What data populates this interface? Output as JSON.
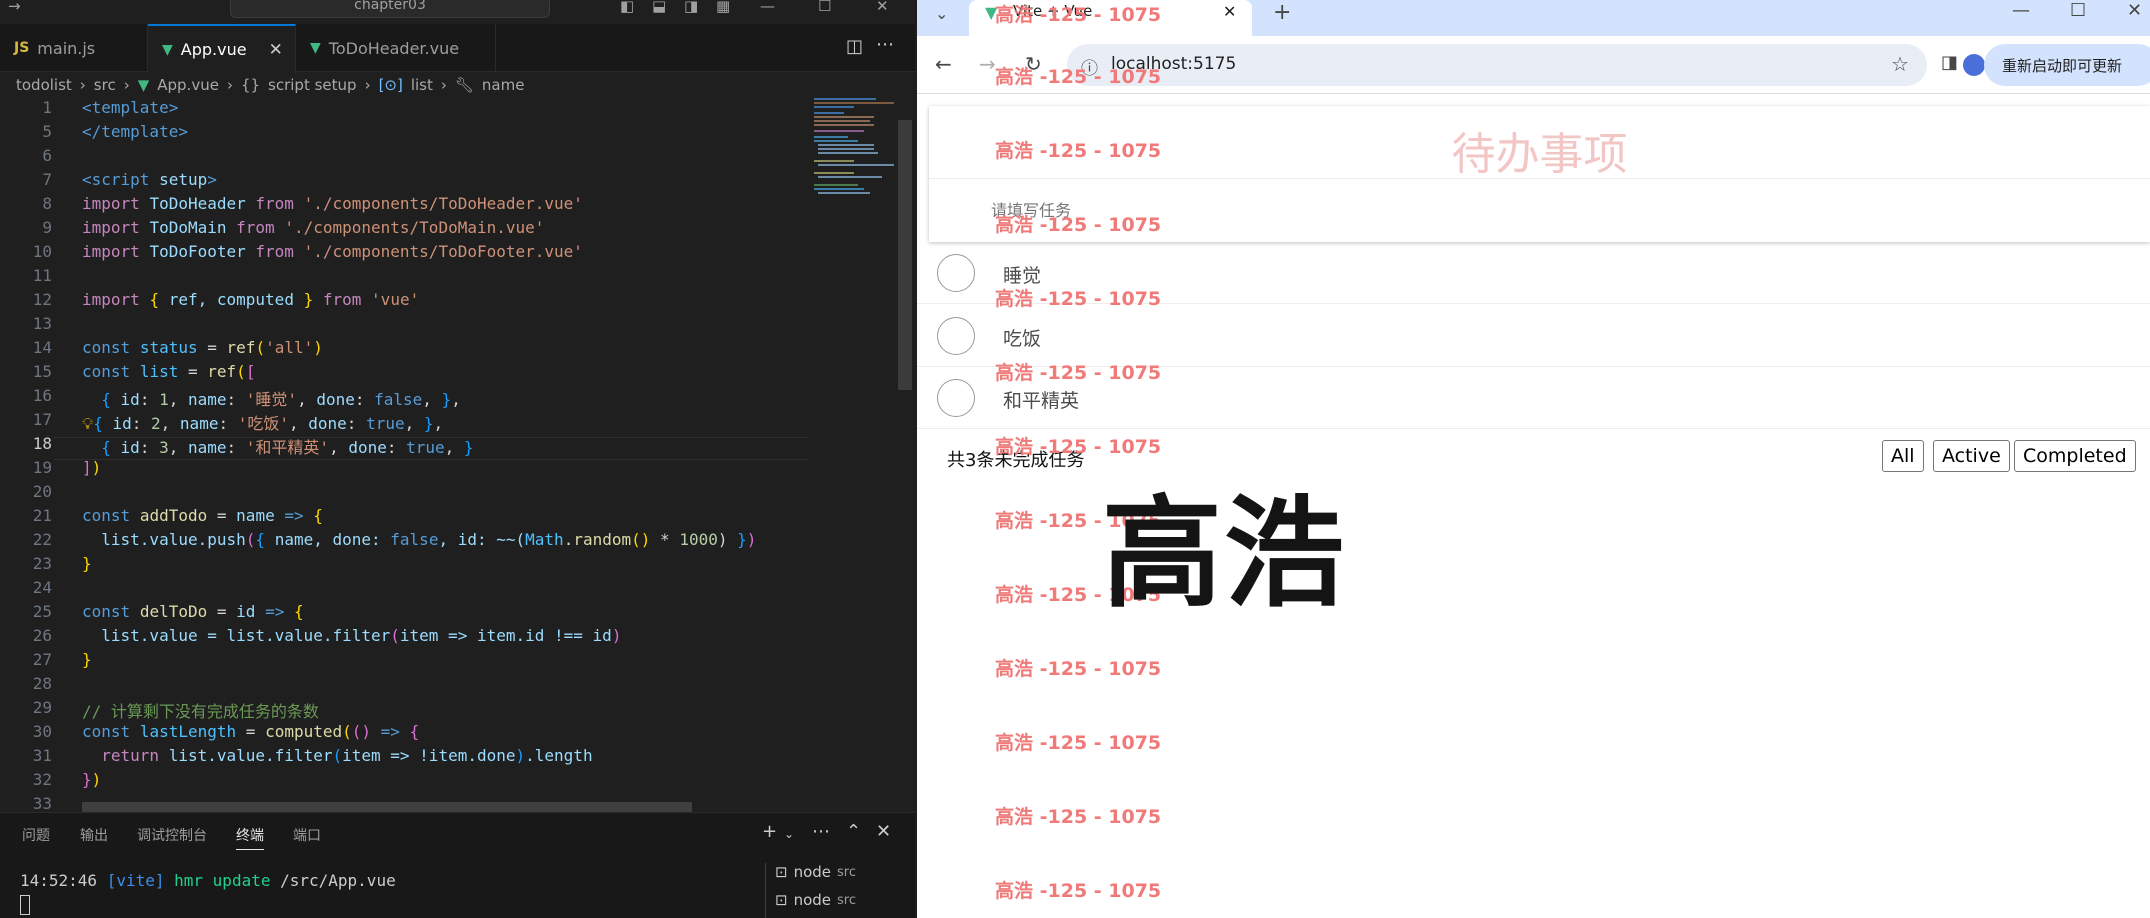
{
  "vscode": {
    "search": "chapter03",
    "tabs": [
      {
        "label": "main.js",
        "icon": "JS"
      },
      {
        "label": "App.vue",
        "icon": "▼"
      },
      {
        "label": "ToDoHeader.vue",
        "icon": "▼"
      }
    ],
    "breadcrumb": [
      "todolist",
      "src",
      "App.vue",
      "script setup",
      "list",
      "name"
    ],
    "line_numbers": [
      "1",
      "5",
      "6",
      "7",
      "8",
      "9",
      "10",
      "11",
      "12",
      "13",
      "14",
      "15",
      "16",
      "17",
      "18",
      "19",
      "20",
      "21",
      "22",
      "23",
      "24",
      "25",
      "26",
      "27",
      "28",
      "29",
      "30",
      "31",
      "32",
      "33"
    ],
    "current_line": "18",
    "code": {
      "l1": "<template>",
      "l5": "</template>",
      "l7a": "<script",
      "l7b": " setup",
      "l7c": ">",
      "import": "import",
      "from": "from",
      "l8_id": "ToDoHeader",
      "l8_path": "'./components/ToDoHeader.vue'",
      "l9_id": "ToDoMain",
      "l9_path": "'./components/ToDoMain.vue'",
      "l10_id": "ToDoFooter",
      "l10_path": "'./components/ToDoFooter.vue'",
      "l12_items": "ref, computed",
      "l12_path": "'vue'",
      "const": "const",
      "l14_var": "status",
      "ref": "ref",
      "l14_arg": "'all'",
      "l15_var": "list",
      "items": [
        {
          "id": "1",
          "name": "'睡觉'",
          "done": "false"
        },
        {
          "id": "2",
          "name": "'吃饭'",
          "done": "true"
        },
        {
          "id": "3",
          "name": "'和平精英'",
          "done": "true"
        }
      ],
      "l21_var": "addTodo",
      "l21_param": "name",
      "l22": "list.value.push",
      "l22_obj": "name, done: ",
      "l22_false": "false",
      "l22_id": ", id: ~~(",
      "l22_math": "Math",
      "l22_random": ".random",
      "l22_num": "1000",
      "l25_var": "delToDo",
      "l25_param": "id",
      "l26": "list.value = list.value.filter",
      "l26_expr": "item => item.id !== id",
      "l29": "// 计算剩下没有完成任务的条数",
      "l30_var": "lastLength",
      "computed": "computed",
      "return": "return",
      "l31": "list.value.filter",
      "l31_expr": "item => !item.done",
      "l31_len": ".length"
    },
    "panel_tabs": [
      "问题",
      "输出",
      "调试控制台",
      "终端",
      "端口"
    ],
    "terminal": {
      "time": "14:52:46",
      "vite": "[vite]",
      "hmr": "hmr update",
      "path": "/src/App.vue"
    },
    "term_list": [
      {
        "label": "node",
        "sub": "src"
      },
      {
        "label": "node",
        "sub": "src"
      }
    ]
  },
  "browser": {
    "tab_title": "Vite + Vue",
    "url": "localhost:5175",
    "update_button": "重新启动即可更新",
    "todo": {
      "title": "待办事项",
      "input_placeholder": "请填写任务",
      "items": [
        "睡觉",
        "吃饭",
        "和平精英"
      ],
      "count_text": "共3条未完成任务",
      "filters": [
        "All",
        "Active",
        "Completed"
      ]
    },
    "watermark": "高浩 -125 - 1075",
    "big_name": "高浩"
  },
  "colors": {
    "vue_green": "#41b883",
    "accent_blue": "#0078d4",
    "watermark_red": "#f07a7a",
    "title_pink": "#f3c6c6"
  }
}
